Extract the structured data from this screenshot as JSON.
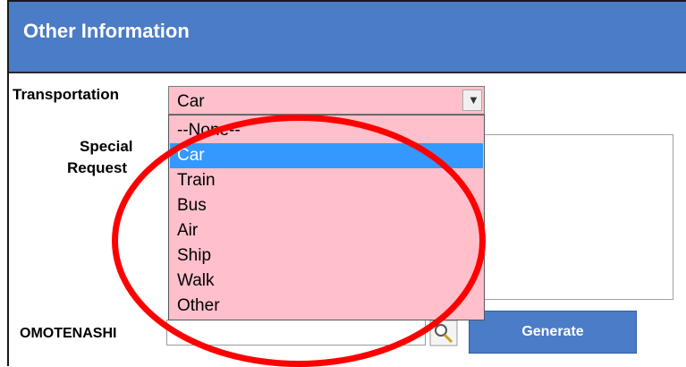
{
  "section": {
    "title": "Other Information"
  },
  "transportation": {
    "label": "Transportation",
    "selected": "Car",
    "options": [
      "--None--",
      "Car",
      "Train",
      "Bus",
      "Air",
      "Ship",
      "Walk",
      "Other"
    ]
  },
  "special_requests": {
    "label_line1": "Special",
    "label_line2": "Request"
  },
  "omotenashi": {
    "label": "OMOTENASHI",
    "value": "",
    "generate_label": "Generate"
  },
  "colors": {
    "header": "#4a7cc7",
    "select_bg": "#ffc0cb",
    "option_highlight": "#3399ff",
    "annotation": "#ff0000"
  },
  "icons": {
    "dropdown_arrow": "chevron-down-icon",
    "lookup": "magnifier-icon"
  }
}
